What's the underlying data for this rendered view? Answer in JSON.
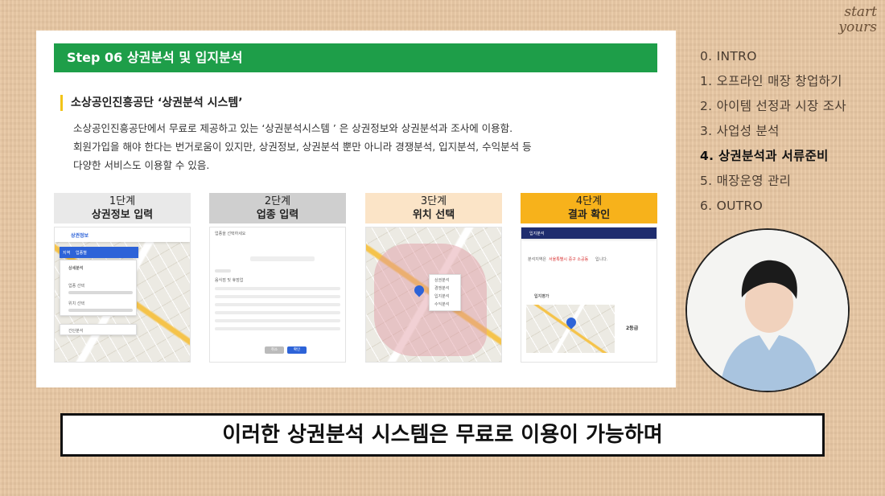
{
  "logo": {
    "line1": "start",
    "line2": "yours"
  },
  "slide": {
    "step_title": "Step 06 상권분석 및 입지분석",
    "section_title": "소상공인진흥공단 ‘상권분석 시스템’",
    "description": [
      "소상공인진흥공단에서 무료로 제공하고 있는 ‘상권분석시스템 ’ 은 상권정보와 상권분석과 조사에 이용함.",
      "회원가입을 해야 한다는 번거로움이 있지만, 상권정보, 상권분석 뿐만 아니라 경쟁분석, 입지분석, 수익분석 등",
      "다양한 서비스도 이용할 수 있음."
    ],
    "cards": [
      {
        "step": "1단계",
        "label": "상권정보 입력",
        "color": "#e9e9e9"
      },
      {
        "step": "2단계",
        "label": "업종 입력",
        "color": "#cfcfcf"
      },
      {
        "step": "3단계",
        "label": "위치 선택",
        "color": "#fbe4c7"
      },
      {
        "step": "4단계",
        "label": "결과 확인",
        "color": "#f7b21b"
      }
    ],
    "card1": {
      "brand": "상권정보",
      "tabs": [
        "지역",
        "업종별"
      ],
      "menu": [
        "상세분석",
        "간단분석"
      ],
      "fields": [
        "업종 선택",
        "위치 선택"
      ]
    },
    "card2": {
      "header": "업종을 선택하세요",
      "sub": "음식점 및 휴점업",
      "buttons": [
        "취소",
        "확인"
      ]
    },
    "card3": {
      "menu": [
        "상권분석",
        "경쟁분석",
        "입지분석",
        "수익분석"
      ]
    },
    "card4": {
      "tab": "입지분석",
      "area_prefix": "분석지역은",
      "area_name": "서울특별시 중구 소공동",
      "area_suffix": "입니다.",
      "section": "입지평가",
      "grade": "2등급"
    }
  },
  "toc": {
    "items": [
      "0. INTRO",
      "1. 오프라인 매장 창업하기",
      "2. 아이템 선정과 시장 조사",
      "3. 사업성 분석",
      "4. 상권분석과 서류준비",
      "5. 매장운영 관리",
      "6. OUTRO"
    ],
    "active_index": 4
  },
  "subtitle": "이러한 상권분석 시스템은 무료로 이용이 가능하며",
  "colors": {
    "accent_green": "#1e9e49",
    "accent_yellow": "#f2c418",
    "background": "#e8c7a3"
  }
}
